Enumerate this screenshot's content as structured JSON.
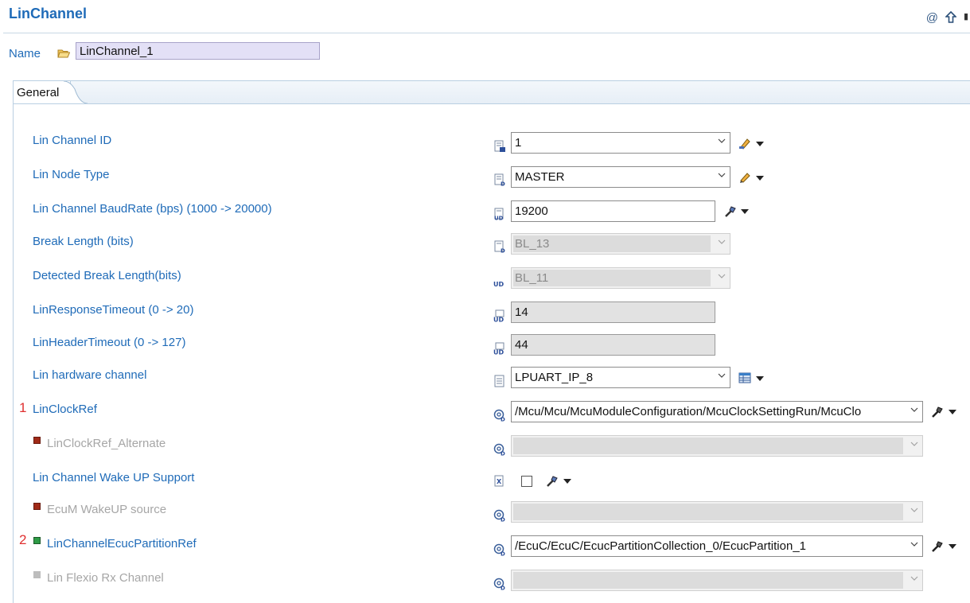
{
  "editor": {
    "title": "LinChannel",
    "name_label": "Name",
    "name_value": "LinChannel_1",
    "tab_general": "General"
  },
  "annotations": {
    "one": "1",
    "two": "2"
  },
  "rows": {
    "lin_channel_id": {
      "label": "Lin Channel ID",
      "value": "1"
    },
    "lin_node_type": {
      "label": "Lin Node Type",
      "value": "MASTER"
    },
    "baudrate": {
      "label": "Lin Channel BaudRate (bps) (1000 -> 20000)",
      "value": "19200"
    },
    "break_length": {
      "label": "Break Length (bits)",
      "value": "BL_13"
    },
    "detected_break_length": {
      "label": "Detected Break Length(bits)",
      "value": "BL_11"
    },
    "response_timeout": {
      "label": "LinResponseTimeout (0 -> 20)",
      "value": "14"
    },
    "header_timeout": {
      "label": "LinHeaderTimeout (0 -> 127)",
      "value": "44"
    },
    "hardware_channel": {
      "label": "Lin hardware channel",
      "value": "LPUART_IP_8"
    },
    "clock_ref": {
      "label": "LinClockRef",
      "value": "/Mcu/Mcu/McuModuleConfiguration/McuClockSettingRun/McuClo"
    },
    "clock_ref_alt": {
      "label": "LinClockRef_Alternate",
      "value": ""
    },
    "wake_up_support": {
      "label": "Lin Channel Wake UP Support",
      "checked": false
    },
    "ecum_wakeup_source": {
      "label": "EcuM WakeUP source",
      "value": ""
    },
    "ecuc_partition_ref": {
      "label": "LinChannelEcucPartitionRef",
      "value": "/EcuC/EcuC/EcucPartitionCollection_0/EcucPartition_1"
    },
    "flexio_rx_channel": {
      "label": "Lin Flexio Rx Channel",
      "value": ""
    }
  },
  "colors": {
    "label_blue": "#1f6bb8",
    "disabled_grey": "#a6a6a6",
    "annotation_red": "#e03030"
  }
}
